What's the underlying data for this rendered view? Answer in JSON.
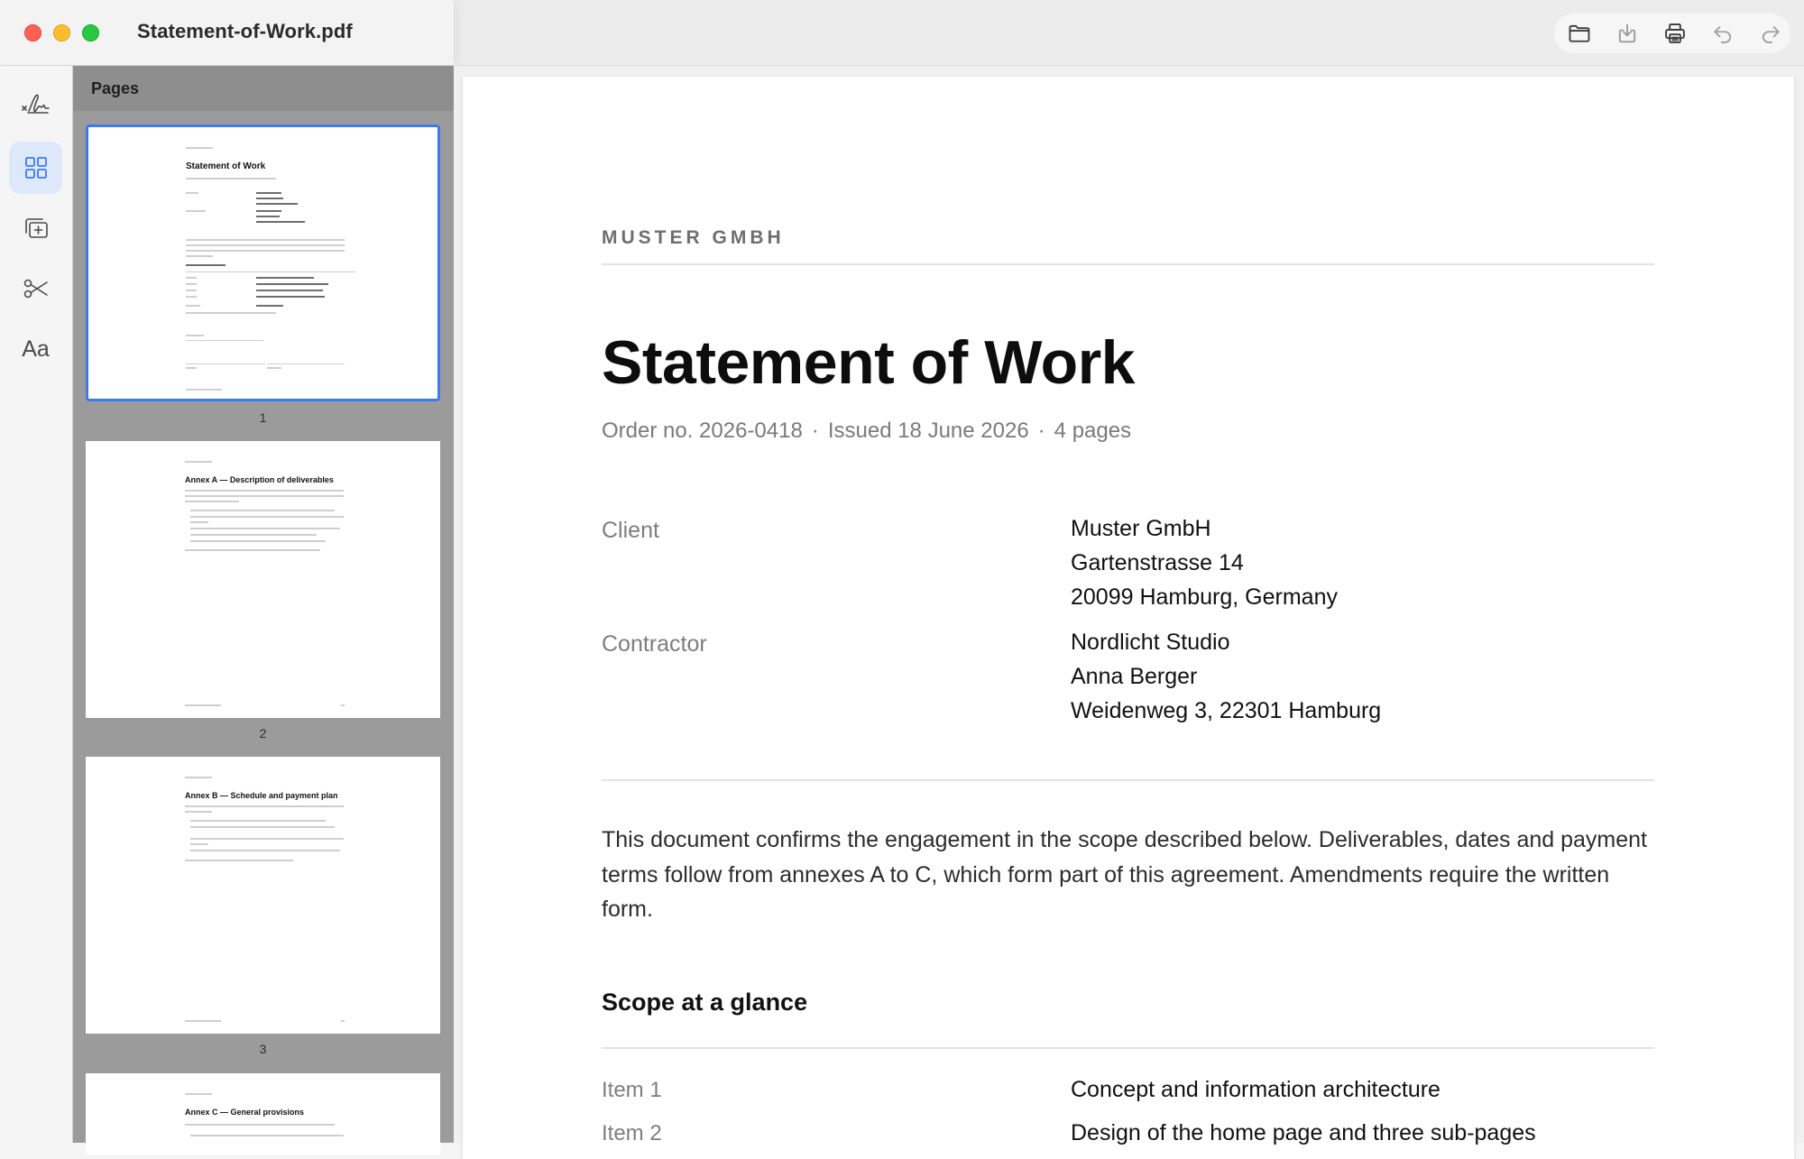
{
  "window": {
    "title": "Statement-of-Work.pdf"
  },
  "toolbar": {
    "icons": [
      "folder-icon",
      "download-icon",
      "print-icon",
      "undo-icon",
      "redo-icon"
    ]
  },
  "rail": {
    "icons": [
      "signature-icon",
      "grid-icon",
      "add-page-icon",
      "scissors-icon",
      "text-icon"
    ],
    "text_label": "Aa"
  },
  "pages_panel": {
    "title": "Pages",
    "thumbnails": [
      {
        "number": "1",
        "heading": "Statement of Work"
      },
      {
        "number": "2",
        "heading": "Annex A — Description of deliverables"
      },
      {
        "number": "3",
        "heading": "Annex B — Schedule and payment plan"
      },
      {
        "number": "4",
        "heading": "Annex C — General provisions"
      }
    ]
  },
  "document": {
    "company": "MUSTER GMBH",
    "title": "Statement of Work",
    "meta": {
      "order": "Order no. 2026-0418",
      "issued": "Issued 18 June 2026",
      "pages": "4 pages",
      "separator": "·"
    },
    "client": {
      "label": "Client",
      "lines": [
        "Muster GmbH",
        "Gartenstrasse 14",
        "20099 Hamburg, Germany"
      ]
    },
    "contractor": {
      "label": "Contractor",
      "lines": [
        "Nordlicht Studio",
        "Anna Berger",
        "Weidenweg 3, 22301 Hamburg"
      ]
    },
    "intro": "This document confirms the engagement in the scope described below. Deliverables, dates and payment terms follow from annexes A to C, which form part of this agreement. Amendments require the written form.",
    "scope_heading": "Scope at a glance",
    "scope_items": [
      {
        "label": "Item 1",
        "value": "Concept and information architecture"
      },
      {
        "label": "Item 2",
        "value": "Design of the home page and three sub-pages"
      }
    ]
  },
  "colors": {
    "accent": "#3a7bf0",
    "active_rail_bg": "#dde9fb",
    "panel_bg": "#9b9b9b"
  }
}
